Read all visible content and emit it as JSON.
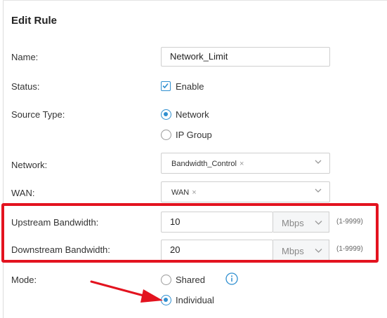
{
  "title": "Edit Rule",
  "fields": {
    "name": {
      "label": "Name:",
      "value": "Network_Limit"
    },
    "status": {
      "label": "Status:",
      "option": "Enable",
      "checked": true
    },
    "source_type": {
      "label": "Source Type:",
      "options": [
        "Network",
        "IP Group"
      ],
      "selected": "Network"
    },
    "network": {
      "label": "Network:",
      "tag": "Bandwidth_Control",
      "tag_remove": "×"
    },
    "wan": {
      "label": "WAN:",
      "tag": "WAN",
      "tag_remove": "×"
    },
    "upstream": {
      "label": "Upstream Bandwidth:",
      "value": "10",
      "unit": "Mbps",
      "range": "(1-9999)"
    },
    "downstream": {
      "label": "Downstream Bandwidth:",
      "value": "20",
      "unit": "Mbps",
      "range": "(1-9999)"
    },
    "mode": {
      "label": "Mode:",
      "options": [
        "Shared",
        "Individual"
      ],
      "selected": "Individual"
    }
  },
  "icons": {
    "checkbox": "check-icon",
    "chevron": "chevron-down-icon",
    "info": "info-icon",
    "annotation": "red-arrow-icon"
  },
  "colors": {
    "accent": "#2f8fd0",
    "highlight": "#e3131f"
  }
}
